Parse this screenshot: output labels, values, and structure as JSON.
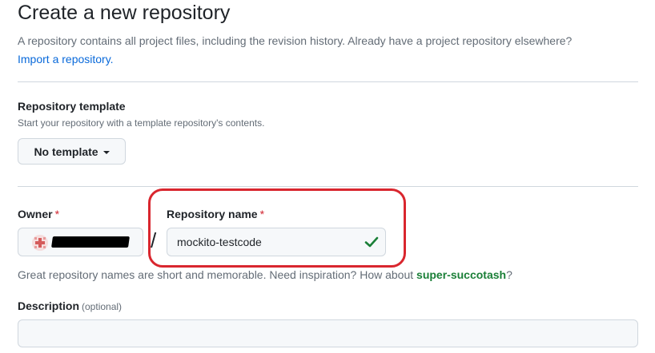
{
  "header": {
    "title": "Create a new repository",
    "subtitle": "A repository contains all project files, including the revision history. Already have a project repository elsewhere?",
    "import_link": "Import a repository."
  },
  "template": {
    "label": "Repository template",
    "hint": "Start your repository with a template repository's contents.",
    "button_label": "No template"
  },
  "owner": {
    "label": "Owner",
    "required_marker": "*"
  },
  "separator": "/",
  "repository_name": {
    "label": "Repository name",
    "required_marker": "*",
    "value": "mockito-testcode",
    "valid": true
  },
  "name_hint": {
    "text": "Great repository names are short and memorable. Need inspiration? How about ",
    "suggestion": "super-succotash",
    "suffix": "?"
  },
  "description": {
    "label": "Description",
    "optional_text": "(optional)",
    "value": ""
  },
  "colors": {
    "link": "#0969da",
    "required": "#d1242f",
    "success": "#1a7f37",
    "highlight_annotation": "#d9262e"
  }
}
